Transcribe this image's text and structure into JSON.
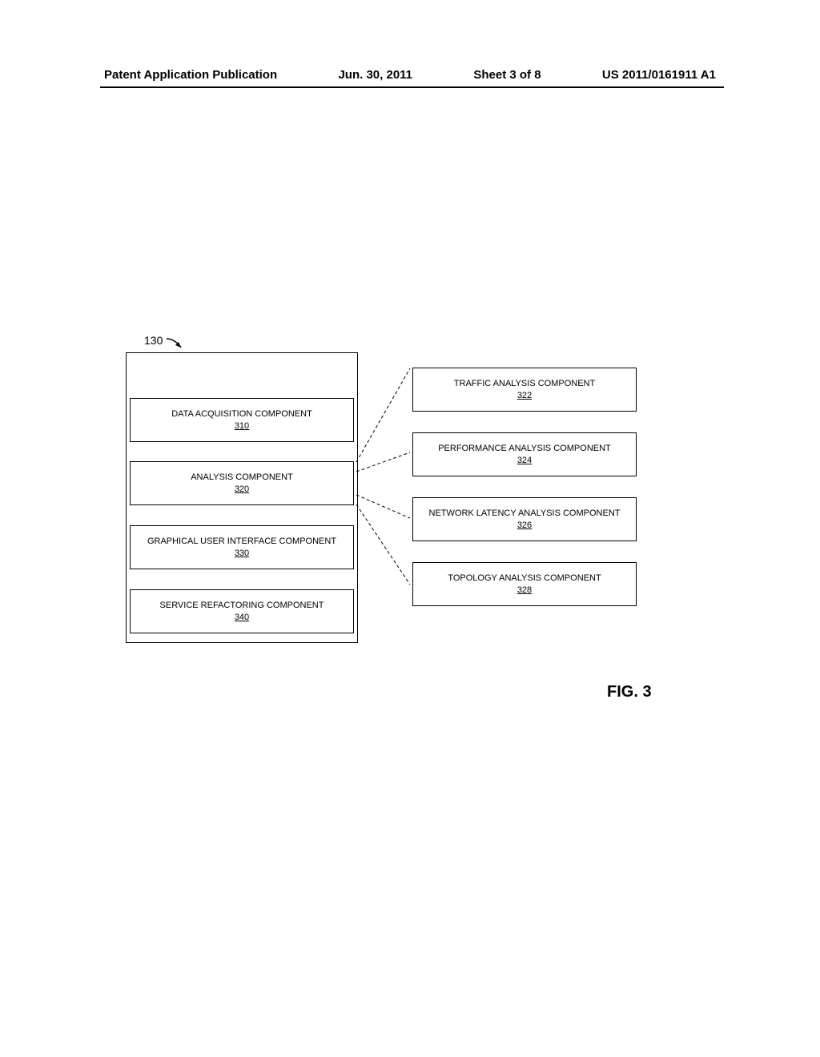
{
  "header": {
    "publication_type": "Patent Application Publication",
    "date": "Jun. 30, 2011",
    "sheet": "Sheet 3 of 8",
    "patent_number": "US 2011/0161911 A1"
  },
  "reference_pointer": "130",
  "left_components": [
    {
      "title": "DATA ACQUISITION COMPONENT",
      "ref": "310"
    },
    {
      "title": "ANALYSIS COMPONENT",
      "ref": "320"
    },
    {
      "title": "GRAPHICAL USER INTERFACE COMPONENT",
      "ref": "330"
    },
    {
      "title": "SERVICE REFACTORING COMPONENT",
      "ref": "340"
    }
  ],
  "right_components": [
    {
      "title": "TRAFFIC ANALYSIS COMPONENT",
      "ref": "322"
    },
    {
      "title": "PERFORMANCE ANALYSIS COMPONENT",
      "ref": "324"
    },
    {
      "title": "NETWORK LATENCY ANALYSIS COMPONENT",
      "ref": "326"
    },
    {
      "title": "TOPOLOGY ANALYSIS COMPONENT",
      "ref": "328"
    }
  ],
  "figure_label": "FIG. 3"
}
